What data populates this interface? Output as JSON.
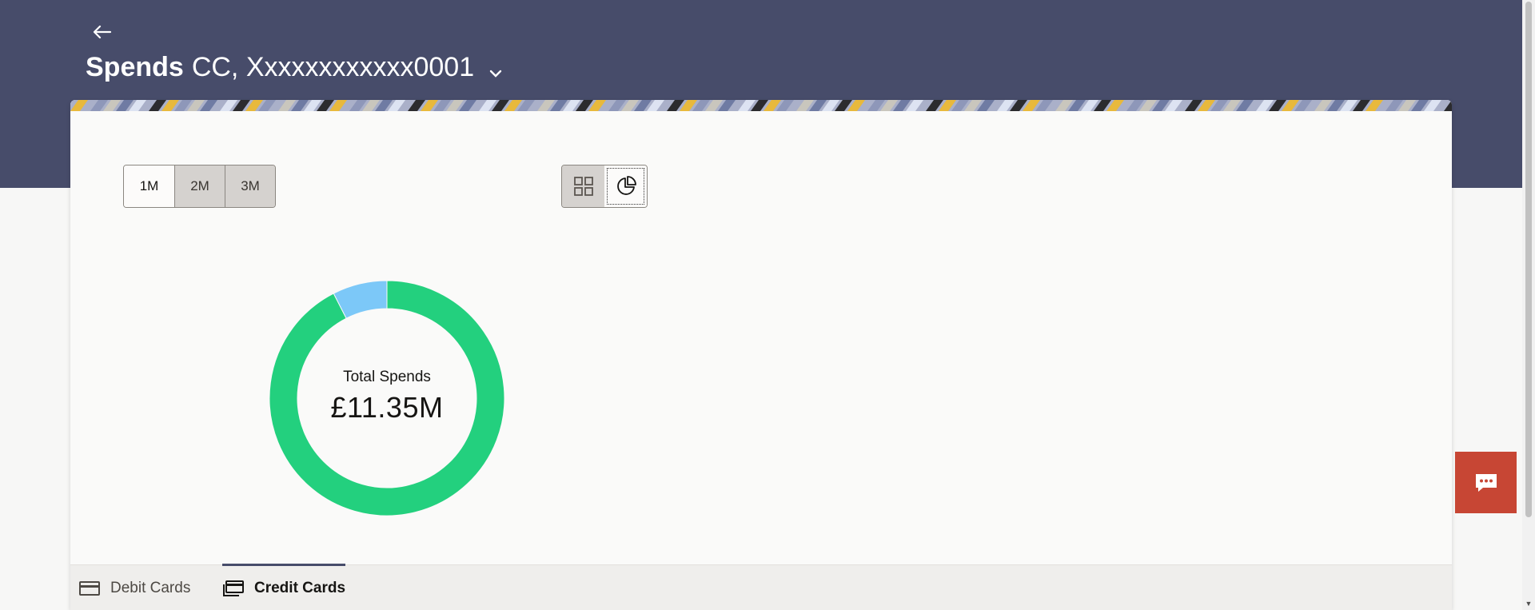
{
  "header": {
    "title_strong": "Spends",
    "account_label": "CC, Xxxxxxxxxxxx0001"
  },
  "period_selector": {
    "options": [
      "1M",
      "2M",
      "3M"
    ],
    "selected": "1M"
  },
  "view_toggle": {
    "options": [
      "grid-view-icon",
      "pie-chart-icon"
    ],
    "selected": "pie-chart-icon"
  },
  "chart_data": {
    "type": "pie",
    "center_label": "Total Spends",
    "center_value": "£11.35M",
    "slices": [
      {
        "share": 0.925,
        "color": "#23d07e"
      },
      {
        "share": 0.075,
        "color": "#7cc8f8"
      }
    ]
  },
  "tabs": [
    {
      "label": "Debit Cards",
      "icon": "debit-card-icon",
      "active": false
    },
    {
      "label": "Credit Cards",
      "icon": "credit-card-icon",
      "active": true
    }
  ],
  "colors": {
    "header_band": "#474c6a",
    "chat_button": "#c74634",
    "primary_slice": "#23d07e",
    "secondary_slice": "#7cc8f8"
  }
}
